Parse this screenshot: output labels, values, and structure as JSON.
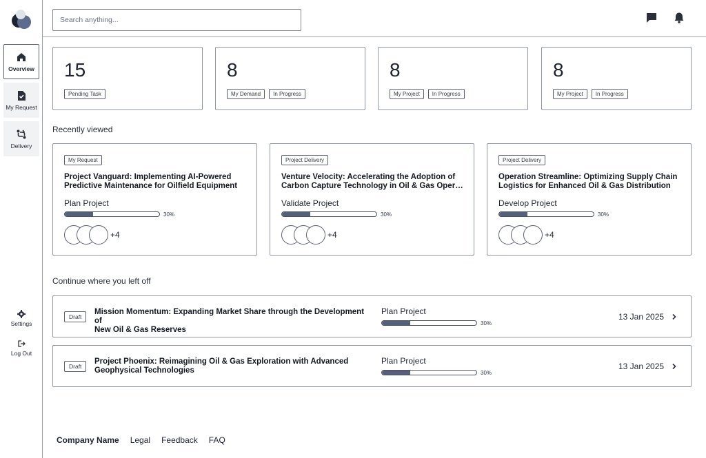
{
  "search": {
    "placeholder": "Search anything..."
  },
  "sidebar": {
    "items": [
      {
        "label": "Overview",
        "icon": "home-icon"
      },
      {
        "label": "My Request",
        "icon": "document-icon"
      },
      {
        "label": "Delivery",
        "icon": "route-icon"
      }
    ],
    "settings_label": "Settings",
    "logout_label": "Log Out"
  },
  "header": {
    "icons": [
      "chat-icon",
      "bell-icon"
    ]
  },
  "stats": [
    {
      "value": "15",
      "badges": [
        "Pending Task"
      ]
    },
    {
      "value": "8",
      "badges": [
        "My Demand",
        "In Progress"
      ]
    },
    {
      "value": "8",
      "badges": [
        "My Project",
        "In Progress"
      ]
    },
    {
      "value": "8",
      "badges": [
        "My Project",
        "In Progress"
      ]
    }
  ],
  "recently_viewed": {
    "title": "Recently viewed",
    "cards": [
      {
        "badge": "My Request",
        "title_line1": "Project Vanguard: Implementing AI-Powered",
        "title_line2": "Predictive Maintenance for Oilfield Equipment",
        "stage": "Plan Project",
        "progress": 30,
        "progress_label": "30%",
        "more": "+4"
      },
      {
        "badge": "Project Delivery",
        "title_line1": "Venture Velocity: Accelerating the Adoption of",
        "title_line2": "Carbon Capture Technology in Oil & Gas Operations",
        "stage": "Validate Project",
        "progress": 30,
        "progress_label": "30%",
        "more": "+4"
      },
      {
        "badge": "Project Delivery",
        "title_line1": "Operation Streamline: Optimizing Supply Chain",
        "title_line2": "Logistics for Enhanced Oil & Gas Distribution",
        "stage": "Develop Project",
        "progress": 30,
        "progress_label": "30%",
        "more": "+4"
      }
    ]
  },
  "continue": {
    "title": "Continue where you left off",
    "rows": [
      {
        "badge": "Draft",
        "title_line1": "Mission Momentum: Expanding Market Share through the Development of",
        "title_line2": "New Oil & Gas Reserves",
        "stage": "Plan Project",
        "progress": 30,
        "progress_label": "30%",
        "date": "13 Jan 2025"
      },
      {
        "badge": "Draft",
        "title_line1": "Project Phoenix: Reimagining Oil & Gas Exploration with Advanced",
        "title_line2": "Geophysical Technologies",
        "stage": "Plan Project",
        "progress": 30,
        "progress_label": "30%",
        "date": "13 Jan 2025"
      }
    ]
  },
  "footer": {
    "brand": "Company Name",
    "links": [
      "Legal",
      "Feedback",
      "FAQ"
    ]
  },
  "colors": {
    "accent": "#55607c",
    "border": "#8e94a0",
    "text": "#1f2430"
  }
}
